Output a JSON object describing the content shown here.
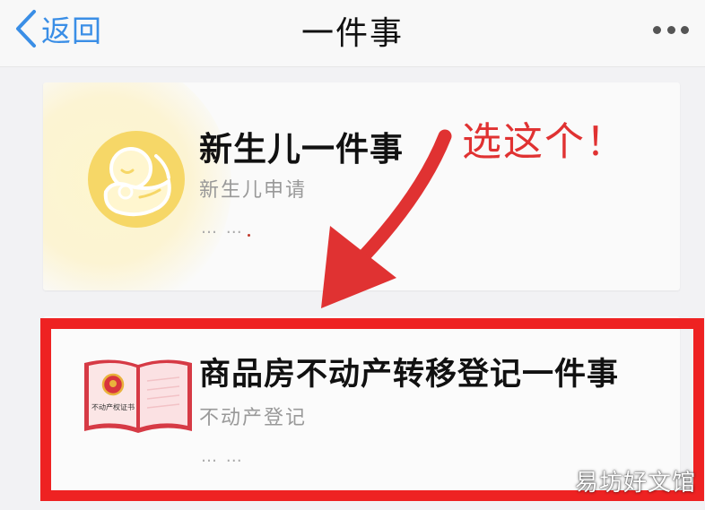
{
  "header": {
    "back_label": "返回",
    "title": "一件事",
    "more_icon": "more-horizontal-icon"
  },
  "cards": [
    {
      "title": "新生儿一件事",
      "subtitle": "新生儿申请",
      "ellipsis": "… …",
      "icon": "newborn-baby-icon"
    },
    {
      "title": "商品房不动产转移登记一件事",
      "subtitle": "不动产登记",
      "ellipsis": "… …",
      "icon": "property-certificate-icon",
      "icon_caption": "不动产权证书"
    }
  ],
  "annotation": {
    "text": "选这个！",
    "color": "#e03232",
    "highlight_color": "#ee2222"
  },
  "watermark": "易坊好文馆",
  "colors": {
    "accent": "#3a8ee6",
    "background": "#f2f2f4",
    "card": "#fafafa"
  }
}
